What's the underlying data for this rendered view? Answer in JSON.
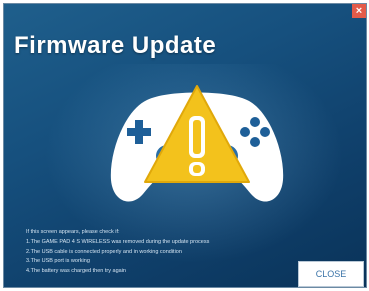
{
  "window": {
    "close_glyph": "×"
  },
  "header": {
    "title": "Firmware Update"
  },
  "illustration": {
    "controller_icon": "gamepad-icon",
    "warning_icon": "warning-triangle-icon",
    "colors": {
      "controller": "#ffffff",
      "accent_blue": "#1e5f98",
      "warning_yellow": "#f3c21c"
    }
  },
  "instructions": {
    "lines": [
      "If this screen appears, please check if:",
      "1.The GAME PAD 4 S WIRELESS was removed during the update process",
      "2.The USB cable is connected properly and in working condition",
      "3.The USB port is working",
      "4.The battery was charged then try again"
    ]
  },
  "footer": {
    "close_label": "CLOSE"
  },
  "colors": {
    "background_top": "#1f5f8c",
    "background_bottom": "#0a3359",
    "title_text": "#ffffff",
    "button_text": "#3b74a8"
  }
}
